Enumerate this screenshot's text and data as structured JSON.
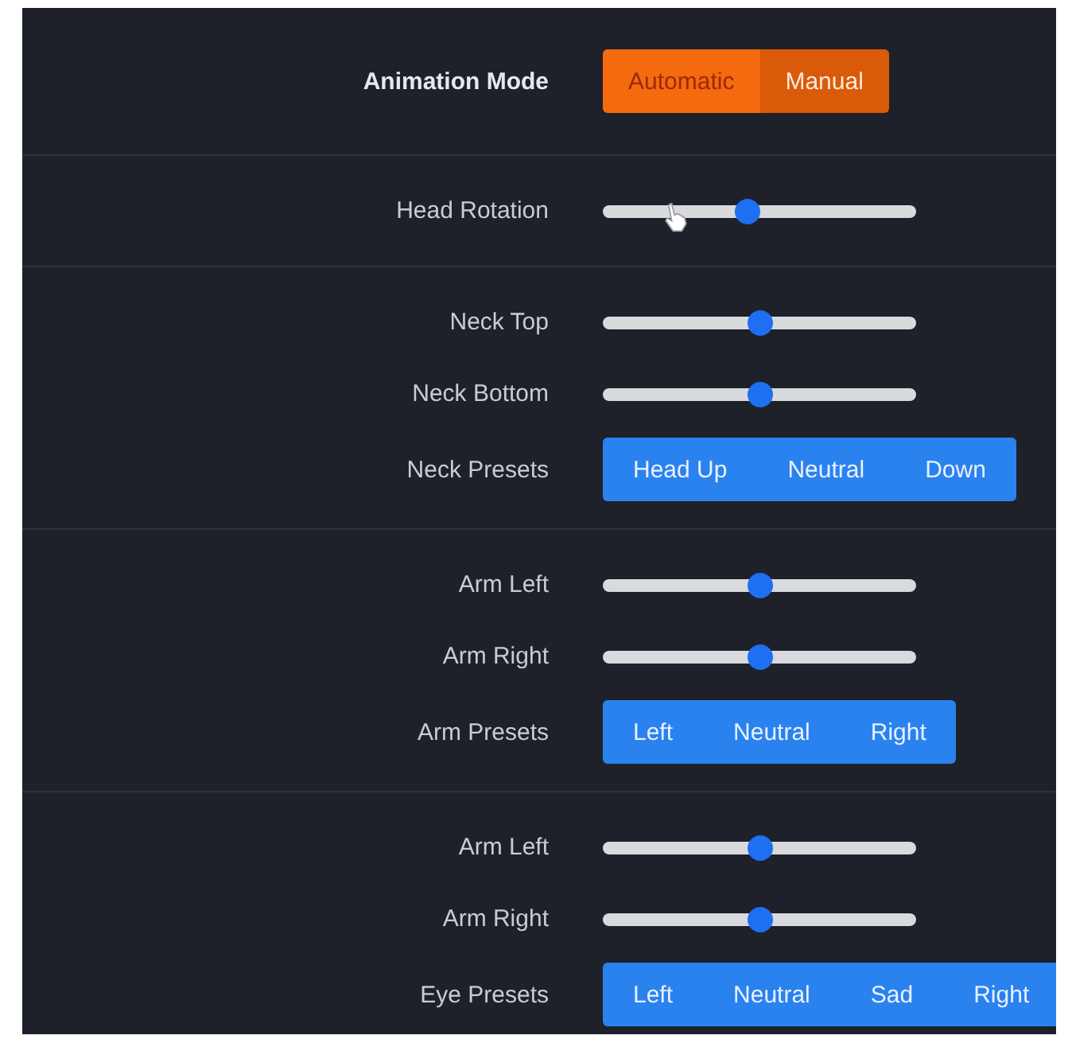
{
  "sections": [
    {
      "rows": [
        {
          "kind": "mode",
          "label": "Animation Mode",
          "options": [
            {
              "label": "Automatic",
              "selected": false
            },
            {
              "label": "Manual",
              "selected": true
            }
          ]
        }
      ]
    },
    {
      "rows": [
        {
          "kind": "slider",
          "label": "Head Rotation",
          "level": 0.46,
          "pointer": true
        }
      ]
    },
    {
      "rows": [
        {
          "kind": "slider",
          "label": "Neck Top",
          "level": 0.5
        },
        {
          "kind": "slider",
          "label": "Neck Bottom",
          "level": 0.5
        },
        {
          "kind": "presets",
          "label": "Neck Presets",
          "options": [
            {
              "label": "Head Up"
            },
            {
              "label": "Neutral"
            },
            {
              "label": "Down"
            }
          ]
        }
      ]
    },
    {
      "rows": [
        {
          "kind": "slider",
          "label": "Arm Left",
          "level": 0.5
        },
        {
          "kind": "slider",
          "label": "Arm Right",
          "level": 0.5
        },
        {
          "kind": "presets",
          "label": "Arm Presets",
          "options": [
            {
              "label": "Left"
            },
            {
              "label": "Neutral"
            },
            {
              "label": "Right"
            }
          ]
        }
      ]
    },
    {
      "rows": [
        {
          "kind": "slider",
          "label": "Arm Left",
          "level": 0.5
        },
        {
          "kind": "slider",
          "label": "Arm Right",
          "level": 0.5
        },
        {
          "kind": "presets",
          "label": "Eye Presets",
          "options": [
            {
              "label": "Left"
            },
            {
              "label": "Neutral"
            },
            {
              "label": "Sad"
            },
            {
              "label": "Right"
            }
          ]
        }
      ]
    }
  ]
}
